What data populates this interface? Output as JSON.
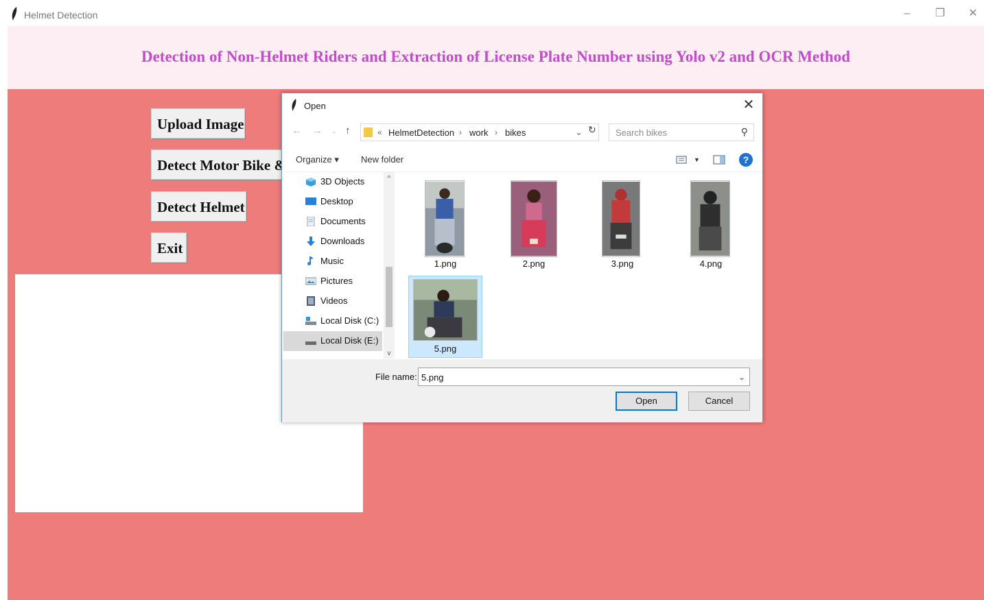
{
  "window": {
    "title": "Helmet Detection",
    "minimize_symbol": "–",
    "restore_symbol": "❐",
    "close_symbol": "✕"
  },
  "header": {
    "heading": "Detection of Non-Helmet Riders and Extraction of License Plate Number using Yolo v2 and OCR Method"
  },
  "buttons": {
    "upload": "Upload Image",
    "detect_bike": "Detect Motor Bike & Person",
    "detect_helmet": "Detect Helmet",
    "exit": "Exit"
  },
  "dialog": {
    "title": "Open",
    "close_symbol": "✕",
    "breadcrumb": {
      "overflow": "«",
      "items": [
        "HelmetDetection",
        "work",
        "bikes"
      ],
      "separator": "›"
    },
    "search_placeholder": "Search bikes",
    "toolbar": {
      "organize": "Organize ▾",
      "new_folder": "New folder",
      "help": "?"
    },
    "nav_items": [
      {
        "label": "3D Objects",
        "icon": "3d-objects-icon"
      },
      {
        "label": "Desktop",
        "icon": "desktop-icon"
      },
      {
        "label": "Documents",
        "icon": "documents-icon"
      },
      {
        "label": "Downloads",
        "icon": "downloads-icon"
      },
      {
        "label": "Music",
        "icon": "music-icon"
      },
      {
        "label": "Pictures",
        "icon": "pictures-icon"
      },
      {
        "label": "Videos",
        "icon": "videos-icon"
      },
      {
        "label": "Local Disk (C:)",
        "icon": "local-disk-icon"
      },
      {
        "label": "Local Disk (E:)",
        "icon": "local-disk-icon",
        "selected": true
      }
    ],
    "files": [
      {
        "name": "1.png"
      },
      {
        "name": "2.png"
      },
      {
        "name": "3.png"
      },
      {
        "name": "4.png"
      },
      {
        "name": "5.png",
        "selected": true
      }
    ],
    "file_name_label": "File name:",
    "file_name_value": "5.png",
    "open_button": "Open",
    "cancel_button": "Cancel"
  },
  "colors": {
    "header_bg": "#fdeef4",
    "heading_text": "#c24ccb",
    "main_bg": "#ee7c7b",
    "selection_bg": "#cce8ff",
    "accent_blue": "#0078d7"
  }
}
